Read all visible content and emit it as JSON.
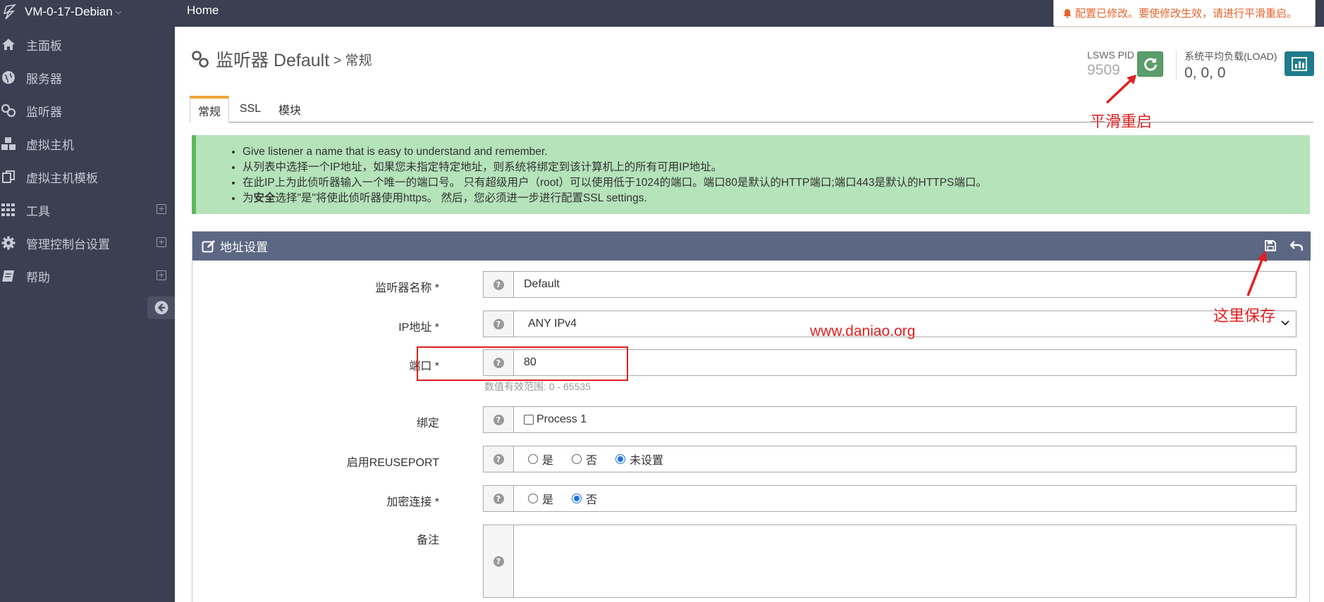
{
  "sidebar": {
    "brand": "VM-0-17-Debian",
    "items": [
      {
        "label": "主面板",
        "icon": "home-icon"
      },
      {
        "label": "服务器",
        "icon": "globe-icon"
      },
      {
        "label": "监听器",
        "icon": "link-icon"
      },
      {
        "label": "虚拟主机",
        "icon": "cubes-icon"
      },
      {
        "label": "虚拟主机模板",
        "icon": "copy-icon"
      },
      {
        "label": "工具",
        "icon": "grid-icon"
      },
      {
        "label": "管理控制台设置",
        "icon": "gear-icon"
      },
      {
        "label": "帮助",
        "icon": "book-icon"
      }
    ]
  },
  "topbar": {
    "home": "Home",
    "alert": "配置已修改。要使修改生效，请进行平滑重启。"
  },
  "header": {
    "title": "监听器 Default",
    "crumb": "> 常规",
    "pid_label": "LSWS PID",
    "pid_value": "9509",
    "load_label": "系统平均负载(LOAD)",
    "load_value": "0, 0, 0"
  },
  "tabs": [
    {
      "label": "常规"
    },
    {
      "label": "SSL"
    },
    {
      "label": "模块"
    }
  ],
  "info": {
    "line1": "Give listener a name that is easy to understand and remember.",
    "line2": "从列表中选择一个IP地址，如果您未指定特定地址，则系统将绑定到该计算机上的所有可用IP地址。",
    "line3": "在此IP上为此侦听器输入一个唯一的端口号。 只有超级用户（root）可以使用低于1024的端口。端口80是默认的HTTP端口;端口443是默认的HTTPS端口。",
    "line4_pre": "为",
    "line4_bold": "安全",
    "line4_post": "选择\"是\"将使此侦听器使用https。 然后，您必须进一步进行配置SSL settings."
  },
  "panel": {
    "title": "地址设置",
    "fields": {
      "name_label": "监听器名称 *",
      "name_value": "Default",
      "ip_label": "IP地址 *",
      "ip_value": "ANY IPv4",
      "port_label": "端口 *",
      "port_value": "80",
      "port_hint": "数值有效范围: 0 - 65535",
      "bind_label": "绑定",
      "bind_option": "Process 1",
      "reuse_label": "启用REUSEPORT",
      "reuse_yes": "是",
      "reuse_no": "否",
      "reuse_unset": "未设置",
      "secure_label": "加密连接 *",
      "secure_yes": "是",
      "secure_no": "否",
      "note_label": "备注",
      "note_value": ""
    }
  },
  "annotations": {
    "restart": "平滑重启",
    "save_here": "这里保存",
    "watermark": "www.daniao.org"
  },
  "colors": {
    "sidebar_bg": "#3a3f51",
    "panel_header": "#5c6784",
    "info_bg": "#b5e3ba",
    "restart_btn": "#5b9d6b",
    "chart_btn": "#1f7a8c",
    "annotation": "#e02020",
    "alert_text": "#e8632b"
  }
}
